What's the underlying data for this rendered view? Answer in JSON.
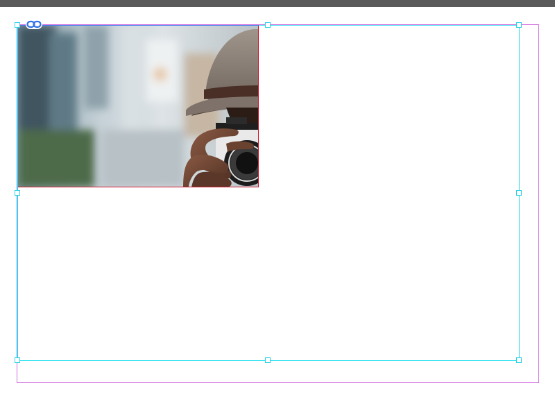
{
  "document": {
    "placed_image": {
      "subject": "person-with-hat-holding-camera-photo"
    },
    "link_badge_icon": "link-icon",
    "colors": {
      "topbar": "#5a5a5a",
      "bleed_guide": "#d36fe0",
      "frame_selection": "#3ee6f2",
      "frame_edge": "#3d7ff0",
      "image_edge": "#d4122b",
      "handle_fill": "#ffffff",
      "link_badge": "#2f6fe8"
    }
  }
}
